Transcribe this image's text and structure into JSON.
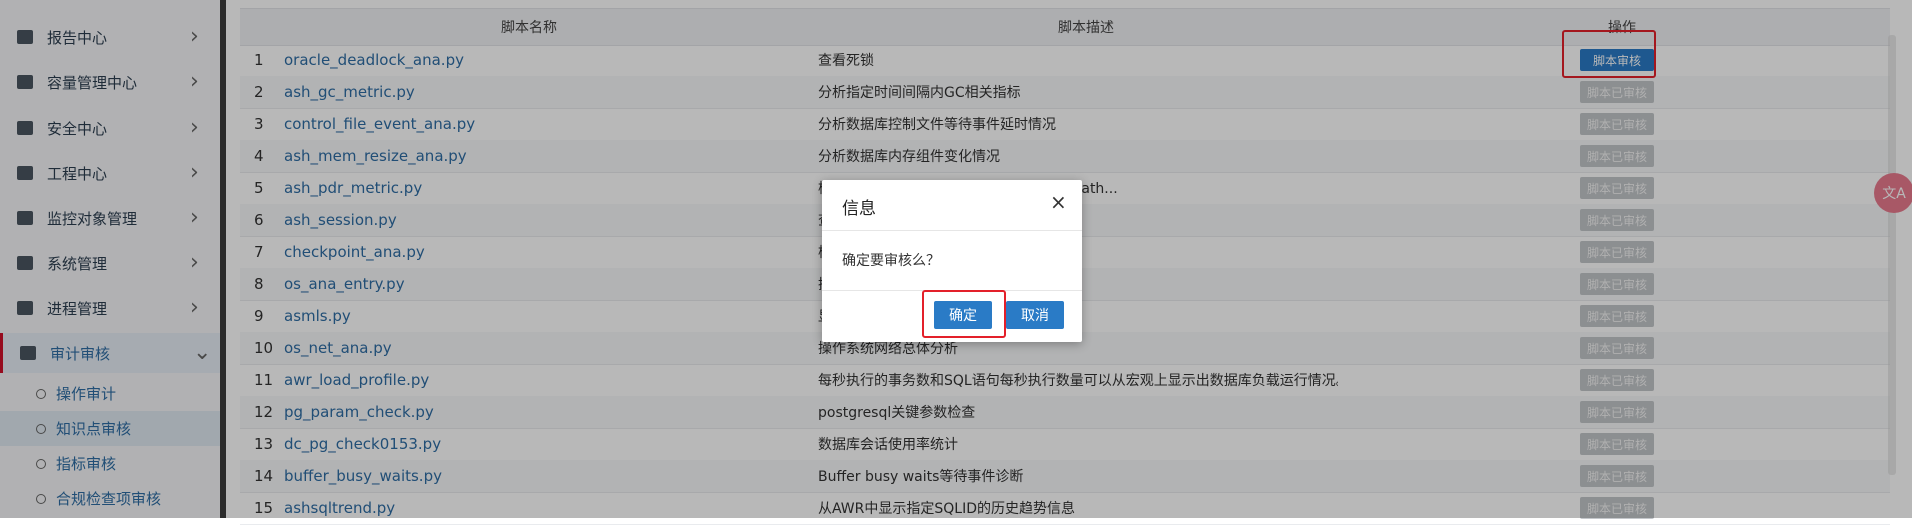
{
  "sidebar": {
    "items": [
      {
        "label": "报告中心",
        "icon": "report-icon"
      },
      {
        "label": "容量管理中心",
        "icon": "database-icon"
      },
      {
        "label": "安全中心",
        "icon": "shield-icon"
      },
      {
        "label": "工程中心",
        "icon": "project-icon"
      },
      {
        "label": "监控对象管理",
        "icon": "monitor-icon"
      },
      {
        "label": "系统管理",
        "icon": "gear-icon"
      },
      {
        "label": "进程管理",
        "icon": "process-icon"
      },
      {
        "label": "审计审核",
        "icon": "audit-icon",
        "expanded": true
      }
    ],
    "sub_items": [
      {
        "label": "操作审计"
      },
      {
        "label": "知识点审核",
        "selected": true
      },
      {
        "label": "指标审核"
      },
      {
        "label": "合规检查项审核"
      }
    ]
  },
  "table": {
    "headers": {
      "name": "脚本名称",
      "desc": "脚本描述",
      "op": "操作"
    },
    "audit_label": "脚本审核",
    "done_label": "脚本已审核",
    "rows": [
      {
        "idx": "1",
        "name": "oracle_deadlock_ana.py",
        "desc": "查看死锁",
        "status": "audit"
      },
      {
        "idx": "2",
        "name": "ash_gc_metric.py",
        "desc": "分析指定时间间隔内GC相关指标",
        "status": "done"
      },
      {
        "idx": "3",
        "name": "control_file_event_ana.py",
        "desc": "分析数据库控制文件等待事件延时情况",
        "status": "done"
      },
      {
        "idx": "4",
        "name": "ash_mem_resize_ana.py",
        "desc": "分析数据库内存组件变化情况",
        "status": "done"
      },
      {
        "idx": "5",
        "name": "ash_pdr_metric.py",
        "desc": "检引起的，如果是建议系统中禁用direct path...",
        "status": "done"
      },
      {
        "idx": "6",
        "name": "ash_session.py",
        "desc": "查",
        "status": "done"
      },
      {
        "idx": "7",
        "name": "checkpoint_ana.py",
        "desc": "检",
        "status": "done"
      },
      {
        "idx": "8",
        "name": "os_ana_entry.py",
        "desc": "操",
        "status": "done"
      },
      {
        "idx": "9",
        "name": "asmls.py",
        "desc": "显",
        "status": "done"
      },
      {
        "idx": "10",
        "name": "os_net_ana.py",
        "desc": "操作系统网络总体分析",
        "status": "done"
      },
      {
        "idx": "11",
        "name": "awr_load_profile.py",
        "desc": "每秒执行的事务数和SQL语句每秒执行数量可以从宏观上显示出数据库负载运行情况。",
        "status": "done"
      },
      {
        "idx": "12",
        "name": "pg_param_check.py",
        "desc": "postgresql关键参数检查",
        "status": "done"
      },
      {
        "idx": "13",
        "name": "dc_pg_check0153.py",
        "desc": "数据库会话使用率统计",
        "status": "done"
      },
      {
        "idx": "14",
        "name": "buffer_busy_waits.py",
        "desc": "Buffer busy waits等待事件诊断",
        "status": "done"
      },
      {
        "idx": "15",
        "name": "ashsqltrend.py",
        "desc": "从AWR中显示指定SQLID的历史趋势信息",
        "status": "done"
      }
    ]
  },
  "modal": {
    "title": "信息",
    "close_icon": "×",
    "message": "确定要审核么？",
    "ok_label": "确定",
    "cancel_label": "取消"
  },
  "floating": {
    "translate_label": "文A"
  }
}
